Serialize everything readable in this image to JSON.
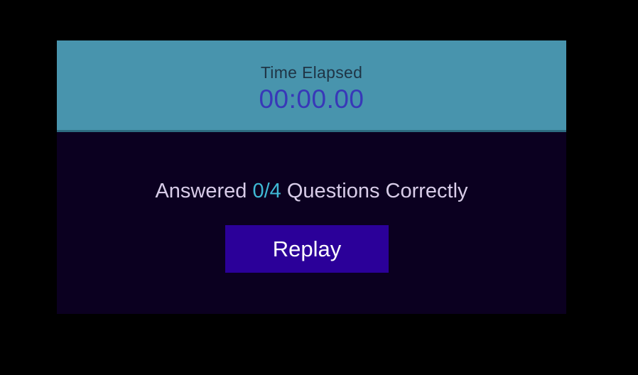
{
  "timer": {
    "label": "Time Elapsed",
    "value": "00:00.00"
  },
  "result": {
    "prefix": "Answered",
    "score": "0/4",
    "suffix": "Questions Correctly"
  },
  "actions": {
    "replay_label": "Replay"
  },
  "colors": {
    "background": "#000000",
    "header": "#4894ad",
    "panel": "#0b0020",
    "timer_value": "#3838b8",
    "score_accent": "#3fb9d6",
    "replay_button": "#2b0099"
  }
}
